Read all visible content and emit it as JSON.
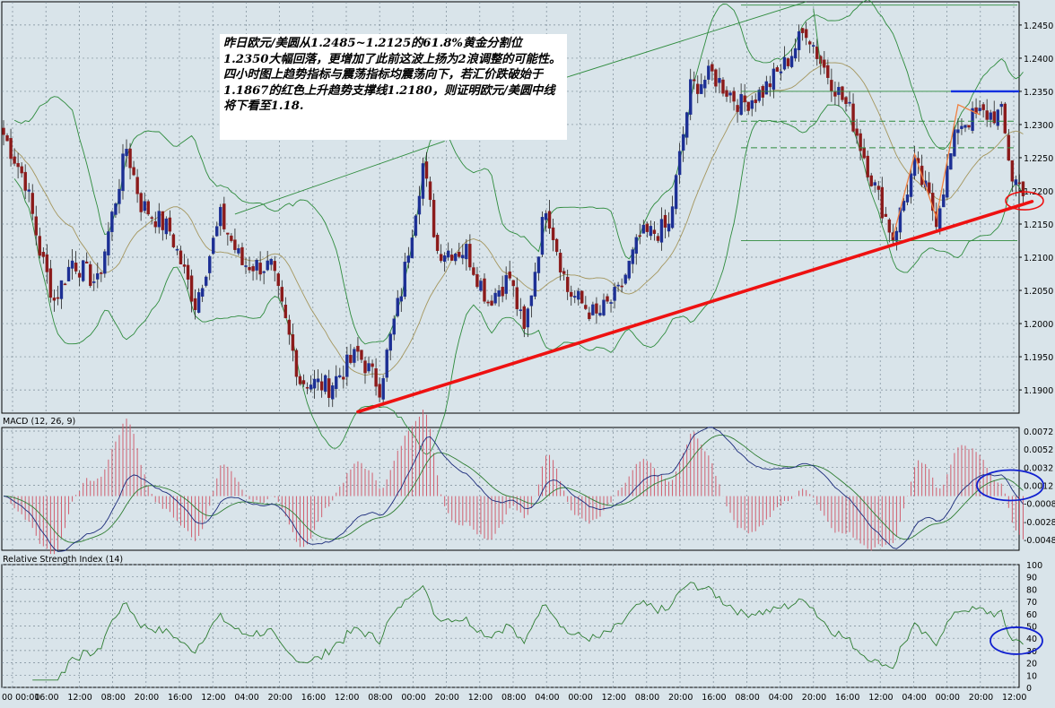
{
  "annotation": "昨日欧元/美圆从1.2485~1.2125的61.8%黄金分割位1.2350大幅回落，更增加了此前这波上扬为2浪调整的可能性。四小时图上趋势指标与震荡指标均震荡向下，若汇价跌破始于1.1867的红色上升趋势支撑线1.2180，则证明欧元/美圆中线将下看至1.18.",
  "colors": {
    "background": "#d9e4ea",
    "bull_candle": "#1c2f94",
    "bear_candle": "#8b1a1a",
    "bands": "#2e8b3d",
    "ma": "#a4965e",
    "trendline": "#ee1111",
    "macd_line": "#1a2a7a",
    "signal_line": "#2e7d32",
    "histogram": "#d06070",
    "rsi": "#2e7d32",
    "highlight_circle_red": "#ee1111",
    "highlight_circle_blue": "#1020d0",
    "resistance": "#1030e0",
    "wave": "#f08040"
  },
  "chart_data": [
    {
      "type": "candlestick",
      "instrument": "EUR/USD",
      "ylim": [
        1.1865,
        1.2485
      ],
      "ytick_labels": [
        "1.2450",
        "1.2400",
        "1.2350",
        "1.2300",
        "1.2250",
        "1.2200",
        "1.2150",
        "1.2100",
        "1.2050",
        "1.2000",
        "1.1950",
        "1.1900"
      ],
      "close_path": {
        "bars": 283,
        "anchors": [
          [
            0,
            1.2285
          ],
          [
            6,
            1.2215
          ],
          [
            10,
            1.211
          ],
          [
            14,
            1.2035
          ],
          [
            19,
            1.2095
          ],
          [
            26,
            1.206
          ],
          [
            34,
            1.2265
          ],
          [
            38,
            1.218
          ],
          [
            46,
            1.214
          ],
          [
            53,
            1.203
          ],
          [
            60,
            1.216
          ],
          [
            66,
            1.209
          ],
          [
            74,
            1.2085
          ],
          [
            82,
            1.1915
          ],
          [
            90,
            1.1905
          ],
          [
            98,
            1.1955
          ],
          [
            104,
            1.1905
          ],
          [
            110,
            1.205
          ],
          [
            116,
            1.224
          ],
          [
            120,
            1.211
          ],
          [
            128,
            1.211
          ],
          [
            134,
            1.2035
          ],
          [
            140,
            1.207
          ],
          [
            144,
            1.1985
          ],
          [
            150,
            1.218
          ],
          [
            156,
            1.205
          ],
          [
            164,
            1.201
          ],
          [
            170,
            1.2045
          ],
          [
            176,
            1.213
          ],
          [
            184,
            1.2145
          ],
          [
            190,
            1.2355
          ],
          [
            196,
            1.2375
          ],
          [
            204,
            1.233
          ],
          [
            210,
            1.235
          ],
          [
            216,
            1.239
          ],
          [
            222,
            1.2445
          ],
          [
            226,
            1.2395
          ],
          [
            234,
            1.232
          ],
          [
            240,
            1.222
          ],
          [
            246,
            1.213
          ],
          [
            252,
            1.224
          ],
          [
            258,
            1.216
          ],
          [
            264,
            1.23
          ],
          [
            270,
            1.2315
          ],
          [
            276,
            1.2315
          ],
          [
            279,
            1.222
          ],
          [
            282,
            1.2205
          ]
        ]
      },
      "overlays": [
        "Bollinger Bands",
        "moving average"
      ],
      "trendline": {
        "from": [
          98,
          1.1867
        ],
        "to": [
          282,
          1.218
        ],
        "color": "#ee1111"
      },
      "resistance_level": 1.235,
      "horizontal_levels": [
        1.248,
        1.235,
        1.2305,
        1.2265,
        1.2125
      ]
    },
    {
      "type": "line",
      "title": "MACD (12, 26, 9)",
      "ylim": [
        -0.006,
        0.0076
      ],
      "ytick_labels": [
        "0.0072",
        "0.0052",
        "0.0032",
        "0.0012",
        "-0.0008",
        "-0.0028",
        "-0.0048"
      ],
      "series": [
        "MACD",
        "signal",
        "histogram"
      ]
    },
    {
      "type": "line",
      "title": "Relative Strength Index (14)",
      "ylim": [
        0,
        100
      ],
      "ytick_labels": [
        "100",
        "90",
        "80",
        "70",
        "60",
        "50",
        "40",
        "30",
        "20",
        "10",
        "0"
      ],
      "series": [
        "RSI"
      ]
    }
  ],
  "x_axis_labels": [
    "00 00:00",
    "16:00",
    "12:00",
    "08:00",
    "20:00",
    "16:00",
    "12:00",
    "04:00",
    "20:00",
    "16:00",
    "12:00",
    "08:00",
    "00:00",
    "20:00",
    "12:00",
    "08:00",
    "04:00",
    "00:00",
    "12:00",
    "08:00",
    "20:00",
    "16:00",
    "08:00",
    "04:00",
    "20:00",
    "16:00",
    "12:00",
    "04:00",
    "00:00",
    "20:00",
    "12:00"
  ]
}
